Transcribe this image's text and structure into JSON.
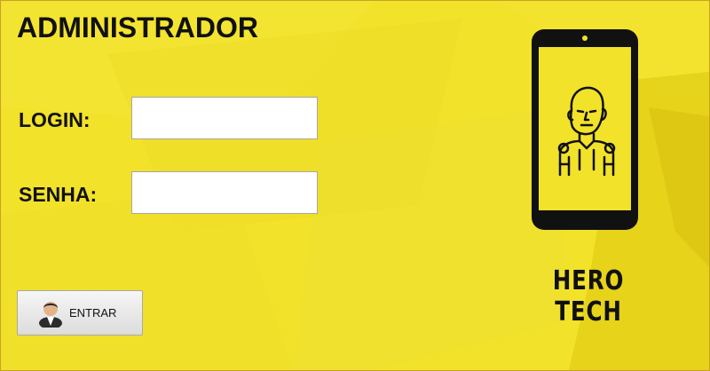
{
  "form": {
    "title": "ADMINISTRADOR",
    "login_label": "LOGIN:",
    "login_value": "",
    "password_label": "SENHA:",
    "password_value": "",
    "submit_label": "ENTRAR",
    "submit_icon": "user-icon"
  },
  "brand": {
    "name": "HERO TECH",
    "logo_icon": "smartphone-hero-icon"
  },
  "colors": {
    "background": "#f2e22a",
    "text": "#111111",
    "button": "#e8e8e8"
  }
}
